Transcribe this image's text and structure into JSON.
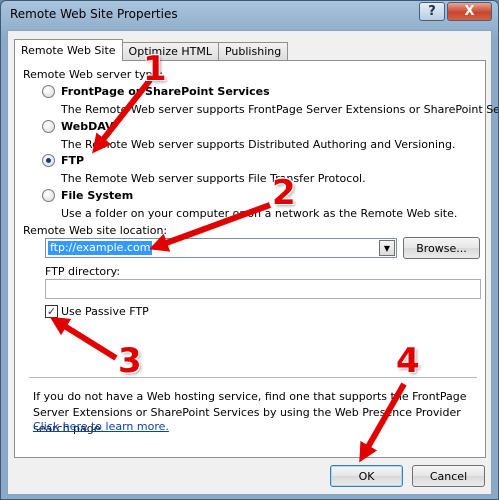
{
  "window": {
    "title": "Remote Web Site Properties",
    "help_glyph": "?",
    "close_glyph": "X"
  },
  "tabs": [
    {
      "label": "Remote Web Site",
      "active": true
    },
    {
      "label": "Optimize HTML",
      "active": false
    },
    {
      "label": "Publishing",
      "active": false
    }
  ],
  "server_type": {
    "heading": "Remote Web server type:",
    "options": [
      {
        "label": "FrontPage or SharePoint Services",
        "description": "The Remote Web server supports FrontPage Server Extensions or SharePoint Services.",
        "checked": false
      },
      {
        "label": "WebDAV",
        "description": "The Remote Web server supports Distributed Authoring and Versioning.",
        "checked": false
      },
      {
        "label": "FTP",
        "description": "The Remote Web server supports File Transfer Protocol.",
        "checked": true
      },
      {
        "label": "File System",
        "description": "Use a folder on your computer or on a network as the Remote Web site.",
        "checked": false
      }
    ]
  },
  "location": {
    "label": "Remote Web site location:",
    "value": "ftp://example.com",
    "browse_label": "Browse..."
  },
  "ftp": {
    "directory_label": "FTP directory:",
    "directory_value": "",
    "passive_label": "Use Passive FTP",
    "passive_checked": true,
    "check_glyph": "✓"
  },
  "info": {
    "text": "If you do not have a Web hosting service, find one that supports the FrontPage Server Extensions or SharePoint Services by using the Web Presence Provider search page.",
    "link": "Click here to learn more."
  },
  "buttons": {
    "ok": "OK",
    "cancel": "Cancel"
  },
  "annotations": {
    "color": "#e10000",
    "numbers": [
      "1",
      "2",
      "3",
      "4"
    ]
  }
}
